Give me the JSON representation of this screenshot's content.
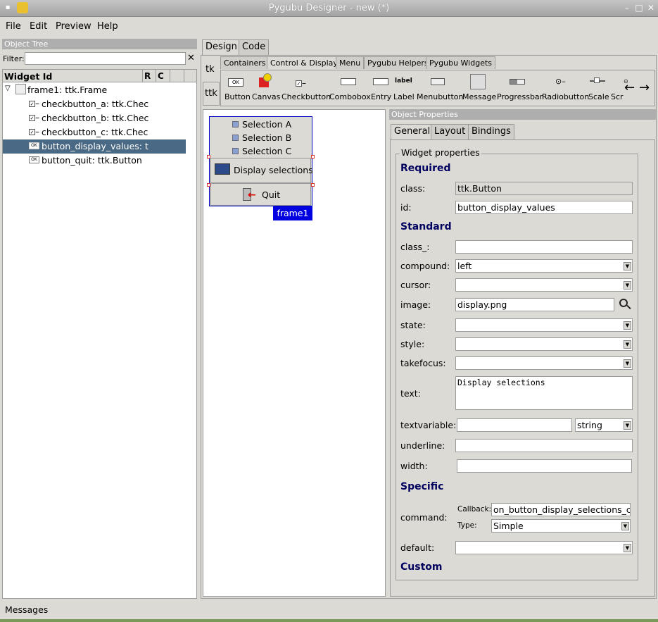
{
  "window": {
    "title": "Pygubu Designer - new (*)"
  },
  "menu": {
    "file": "File",
    "edit": "Edit",
    "preview": "Preview",
    "help": "Help"
  },
  "object_tree": {
    "header": "Object Tree",
    "filter_label": "Filter:",
    "filter_value": "",
    "clear": "✕",
    "col_widget": "Widget Id",
    "col_r": "R",
    "col_c": "C",
    "items": [
      {
        "label": "frame1: ttk.Frame"
      },
      {
        "label": "checkbutton_a: ttk.Chec"
      },
      {
        "label": "checkbutton_b: ttk.Chec"
      },
      {
        "label": "checkbutton_c: ttk.Chec"
      },
      {
        "label": "button_display_values: t"
      },
      {
        "label": "button_quit: ttk.Button"
      }
    ]
  },
  "main_tabs": {
    "design": "Design",
    "code": "Code"
  },
  "side_tabs": {
    "tk": "tk",
    "ttk": "ttk"
  },
  "palette_tabs": [
    "Containers",
    "Control & Display",
    "Menu",
    "Pygubu Helpers",
    "Pygubu Widgets"
  ],
  "palette_items": [
    "Button",
    "Canvas",
    "Checkbutton",
    "Combobox",
    "Entry",
    "Label",
    "Menubutton",
    "Message",
    "Progressbar",
    "Radiobutton",
    "Scale",
    "Scr"
  ],
  "palette_icon_text": {
    "button": "OK",
    "label": "label"
  },
  "preview": {
    "checks": [
      "Selection A",
      "Selection B",
      "Selection C"
    ],
    "display_button": "Display selections",
    "quit_button": "Quit",
    "frame_tag": "frame1"
  },
  "props": {
    "header": "Object Properties",
    "tabs": [
      "General",
      "Layout",
      "Bindings"
    ],
    "group": "Widget properties",
    "required": "Required",
    "standard": "Standard",
    "specific": "Specific",
    "custom": "Custom",
    "class_label": "class:",
    "class_value": "ttk.Button",
    "id_label": "id:",
    "id_value": "button_display_values",
    "class__label": "class_:",
    "compound_label": "compound:",
    "compound_value": "left",
    "cursor_label": "cursor:",
    "image_label": "image:",
    "image_value": "display.png",
    "state_label": "state:",
    "style_label": "style:",
    "takefocus_label": "takefocus:",
    "text_label": "text:",
    "text_value": "Display selections",
    "textvariable_label": "textvariable:",
    "textvariable_type": "string",
    "underline_label": "underline:",
    "width_label": "width:",
    "command_label": "command:",
    "callback_label": "Callback:",
    "callback_value": "on_button_display_selections_cli",
    "type_label": "Type:",
    "type_value": "Simple",
    "default_label": "default:"
  },
  "status": {
    "messages": "Messages"
  }
}
